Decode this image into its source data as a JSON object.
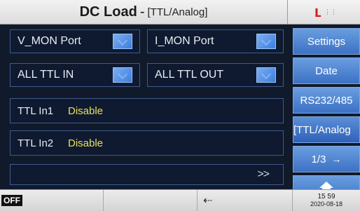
{
  "title": {
    "main": "DC Load",
    "separator": "-",
    "mode": "[TTL/Analog]"
  },
  "logo": {
    "text": "⋮⋮"
  },
  "ports": {
    "v_mon": "V_MON Port",
    "i_mon": "I_MON Port",
    "all_ttl_in": "ALL TTL IN",
    "all_ttl_out": "ALL TTL OUT"
  },
  "ttl_inputs": [
    {
      "name": "TTL In1",
      "value": "Disable"
    },
    {
      "name": "TTL In2",
      "value": "Disable"
    }
  ],
  "nav": {
    "more": ">>"
  },
  "side_menu": {
    "settings": "Settings",
    "date": "Date",
    "rs232": "RS232/485",
    "ttl_analog": "[TTL/Analog",
    "page": "1/3",
    "page_arrow": "→",
    "home_icon": "home-icon"
  },
  "status": {
    "output_state": "OFF",
    "usb_symbol": "⇠",
    "time": "15 59",
    "date": "2020-08-18"
  },
  "colors": {
    "background": "#111a2b",
    "button_blue": "#4a80d0",
    "value_yellow": "#e6e05a",
    "logo_red": "#d41c1c"
  }
}
